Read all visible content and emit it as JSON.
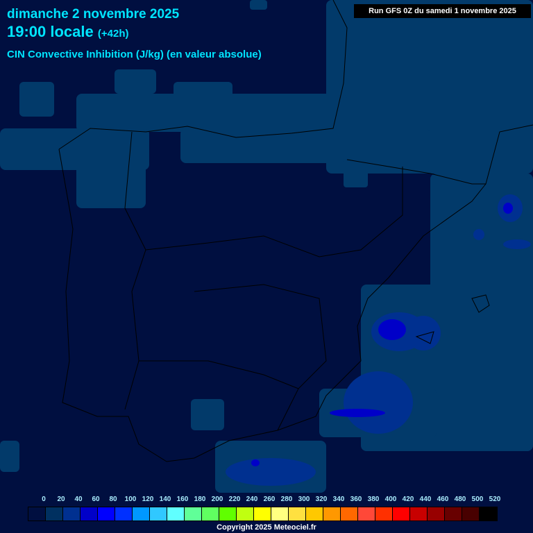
{
  "header": {
    "date": "dimanche 2 novembre 2025",
    "time": "19:00 locale",
    "offset": "(+42h)",
    "variable": "CIN Convective Inhibition (J/kg) (en valeur absolue)",
    "run": "Run GFS 0Z du samedi 1 novembre 2025"
  },
  "legend": {
    "labels": [
      "0",
      "20",
      "40",
      "60",
      "80",
      "100",
      "120",
      "140",
      "160",
      "180",
      "200",
      "220",
      "240",
      "260",
      "280",
      "300",
      "320",
      "340",
      "360",
      "380",
      "400",
      "420",
      "440",
      "460",
      "480",
      "500",
      "520"
    ],
    "colors": [
      "#000f40",
      "#003060",
      "#003090",
      "#0000c8",
      "#0000ff",
      "#0030ff",
      "#0098ff",
      "#30c8ff",
      "#60ffff",
      "#60ff98",
      "#60ff60",
      "#60ff00",
      "#c0ff10",
      "#ffff00",
      "#ffff80",
      "#ffe040",
      "#ffc800",
      "#ff9800",
      "#ff6800",
      "#ff4838",
      "#ff3000",
      "#ff0000",
      "#c80000",
      "#980000",
      "#680000",
      "#480000",
      "#000000"
    ]
  },
  "copyright": "Copyright 2025 Meteociel.fr"
}
